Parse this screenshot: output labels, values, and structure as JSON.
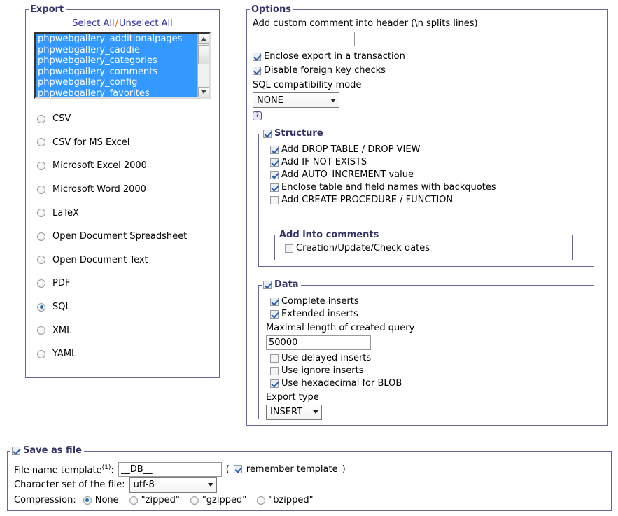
{
  "export_panel": {
    "legend": "Export",
    "select_all_label": "Select All",
    "separator": "/",
    "unselect_all_label": "Unselect All",
    "tables": [
      "phpwebgallery_additionalpages",
      "phpwebgallery_caddie",
      "phpwebgallery_categories",
      "phpwebgallery_comments",
      "phpwebgallery_config",
      "phpwebgallery_favorites"
    ],
    "selected_format": "SQL",
    "formats": [
      "CSV",
      "CSV for MS Excel",
      "Microsoft Excel 2000",
      "Microsoft Word 2000",
      "LaTeX",
      "Open Document Spreadsheet",
      "Open Document Text",
      "PDF",
      "SQL",
      "XML",
      "YAML"
    ]
  },
  "options_panel": {
    "legend": "Options",
    "custom_comment_label": "Add custom comment into header (\\n splits lines)",
    "custom_comment_value": "",
    "enclose_transaction_label": "Enclose export in a transaction",
    "enclose_transaction_checked": true,
    "disable_fk_label": "Disable foreign key checks",
    "disable_fk_checked": true,
    "sql_compat_label": "SQL compatibility mode",
    "sql_compat_value": "NONE",
    "help_icon": "help-question-icon",
    "structure": {
      "legend": "Structure",
      "legend_checked": true,
      "items": [
        {
          "label": "Add DROP TABLE / DROP VIEW",
          "checked": true
        },
        {
          "label": "Add IF NOT EXISTS",
          "checked": true
        },
        {
          "label": "Add AUTO_INCREMENT value",
          "checked": true
        },
        {
          "label": "Enclose table and field names with backquotes",
          "checked": true
        },
        {
          "label": "Add CREATE PROCEDURE / FUNCTION",
          "checked": false
        }
      ],
      "comments": {
        "legend": "Add into comments",
        "items": [
          {
            "label": "Creation/Update/Check dates",
            "checked": false
          }
        ]
      }
    },
    "data": {
      "legend": "Data",
      "legend_checked": true,
      "complete_inserts": {
        "label": "Complete inserts",
        "checked": true
      },
      "extended_inserts": {
        "label": "Extended inserts",
        "checked": true
      },
      "max_query_label": "Maximal length of created query",
      "max_query_value": "50000",
      "delayed_inserts": {
        "label": "Use delayed inserts",
        "checked": false
      },
      "ignore_inserts": {
        "label": "Use ignore inserts",
        "checked": false
      },
      "hex_blob": {
        "label": "Use hexadecimal for BLOB",
        "checked": true
      },
      "export_type_label": "Export type",
      "export_type_value": "INSERT"
    }
  },
  "save_as_file": {
    "legend": "Save as file",
    "legend_checked": true,
    "filename_label": "File name template",
    "filename_sup": "(1)",
    "filename_colon": ":",
    "filename_value": "__DB__",
    "paren_open": "(",
    "remember_label": "remember template",
    "remember_checked": true,
    "paren_close": ")",
    "charset_label": "Character set of the file:",
    "charset_value": "utf-8",
    "compression_label": "Compression:",
    "compression_options": [
      {
        "label": "None",
        "selected": true
      },
      {
        "label": "\"zipped\"",
        "selected": false
      },
      {
        "label": "\"gzipped\"",
        "selected": false
      },
      {
        "label": "\"bzipped\"",
        "selected": false
      }
    ]
  },
  "colors": {
    "fieldset_border": "#666699",
    "legend_text": "#333366",
    "link": "#333399",
    "separator": "#ff6600",
    "selection_bg": "#3399ff",
    "check_mark": "#2a5db0"
  }
}
